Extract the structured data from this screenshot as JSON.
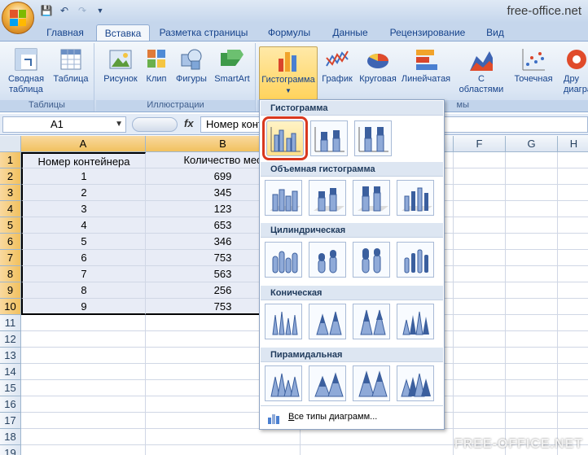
{
  "window": {
    "title": "free-office.net"
  },
  "tabs": [
    {
      "label": "Главная"
    },
    {
      "label": "Вставка"
    },
    {
      "label": "Разметка страницы"
    },
    {
      "label": "Формулы"
    },
    {
      "label": "Данные"
    },
    {
      "label": "Рецензирование"
    },
    {
      "label": "Вид"
    }
  ],
  "ribbon": {
    "groups": {
      "tables": {
        "label": "Таблицы",
        "pivot_l1": "Сводная",
        "pivot_l2": "таблица",
        "table": "Таблица"
      },
      "illustrations": {
        "label": "Иллюстрации",
        "picture": "Рисунок",
        "clip": "Клип",
        "shapes": "Фигуры",
        "smartart": "SmartArt"
      },
      "charts": {
        "label_partial": "мы",
        "histogram": "Гистограмма",
        "graph": "График",
        "pie": "Круговая",
        "linear": "Линейчатая",
        "area_l1": "С",
        "area_l2": "областями",
        "scatter": "Точечная",
        "other_l1": "Дру",
        "other_l2": "диагра"
      }
    }
  },
  "formula_bar": {
    "name_box": "A1",
    "fx": "fx",
    "value": "Номер конт"
  },
  "sheet": {
    "columns": [
      "A",
      "B",
      "F",
      "G",
      "H"
    ],
    "rows": [
      "1",
      "2",
      "3",
      "4",
      "5",
      "6",
      "7",
      "8",
      "9",
      "10",
      "11",
      "12",
      "13",
      "14",
      "15",
      "16",
      "17",
      "18",
      "19"
    ],
    "header_a": "Номер контейнера",
    "header_b": "Количество мес",
    "data": [
      {
        "a": "1",
        "b": "699"
      },
      {
        "a": "2",
        "b": "345"
      },
      {
        "a": "3",
        "b": "123"
      },
      {
        "a": "4",
        "b": "653"
      },
      {
        "a": "5",
        "b": "346"
      },
      {
        "a": "6",
        "b": "753"
      },
      {
        "a": "7",
        "b": "563"
      },
      {
        "a": "8",
        "b": "256"
      },
      {
        "a": "9",
        "b": "753"
      }
    ]
  },
  "gallery": {
    "sections": [
      {
        "title": "Гистограмма"
      },
      {
        "title": "Объемная гистограмма"
      },
      {
        "title": "Цилиндрическая"
      },
      {
        "title": "Коническая"
      },
      {
        "title": "Пирамидальная"
      }
    ],
    "footer": "Все типы диаграмм...",
    "footer_u": "В"
  },
  "watermark": "FREE-OFFICE.NET",
  "colors": {
    "accent_red": "#d9381e",
    "ribbon_bg": "#dbe6f4",
    "select_orange": "#f1c15f"
  }
}
